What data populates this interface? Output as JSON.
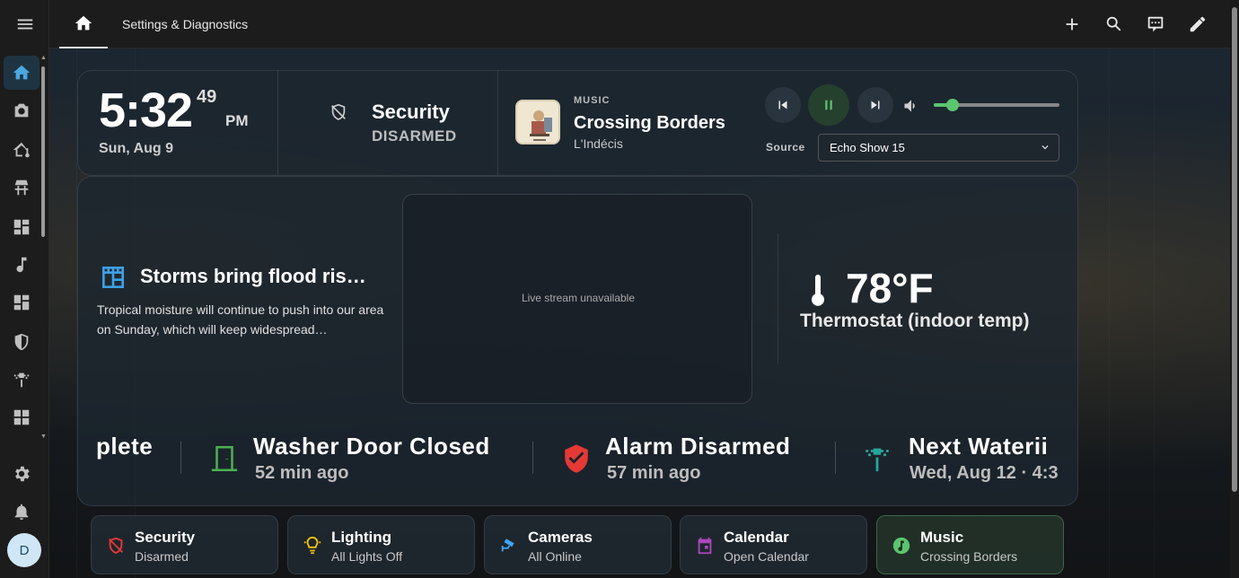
{
  "header": {
    "title": "Settings & Diagnostics"
  },
  "clock": {
    "time": "5:32",
    "seconds": "49",
    "ampm": "PM",
    "date": "Sun, Aug 9"
  },
  "security": {
    "title": "Security",
    "state": "DISARMED"
  },
  "music": {
    "tag": "MUSIC",
    "title": "Crossing Borders",
    "artist": "L'Indécis",
    "source_label": "Source",
    "source_value": "Echo Show 15",
    "volume": 0.15
  },
  "news": {
    "title": "Storms bring flood ris…",
    "body": "Tropical moisture will continue to push into our area on Sunday, which will keep widespread…"
  },
  "stream": {
    "text": "Live stream unavailable"
  },
  "thermostat": {
    "value": "78°F",
    "label": "Thermostat (indoor temp)"
  },
  "ticker": [
    {
      "title": "plete",
      "sub": ""
    },
    {
      "title": "Washer Door Closed",
      "sub": "52 min ago",
      "icon": "door-icon",
      "color": "#4caf50"
    },
    {
      "title": "Alarm Disarmed",
      "sub": "57 min ago",
      "icon": "shield-check-icon",
      "color": "#e53935"
    },
    {
      "title": "Next Waterii",
      "sub": "Wed, Aug 12 · 4:3",
      "icon": "sprinkler-icon",
      "color": "#26a69a"
    }
  ],
  "tiles": [
    {
      "title": "Security",
      "sub": "Disarmed",
      "icon": "shield-off-icon",
      "color": "#e53935"
    },
    {
      "title": "Lighting",
      "sub": "All Lights Off",
      "icon": "lights-icon",
      "color": "#f4c20d"
    },
    {
      "title": "Cameras",
      "sub": "All Online",
      "icon": "cctv-icon",
      "color": "#42a5f5"
    },
    {
      "title": "Calendar",
      "sub": "Open Calendar",
      "icon": "calendar-icon",
      "color": "#ab47bc"
    },
    {
      "title": "Music",
      "sub": "Crossing Borders",
      "icon": "music-icon",
      "color": "#5bc46e"
    }
  ],
  "user": {
    "initial": "D"
  },
  "colors": {
    "accent": "#4aa8e0",
    "play": "#5bc46e"
  }
}
